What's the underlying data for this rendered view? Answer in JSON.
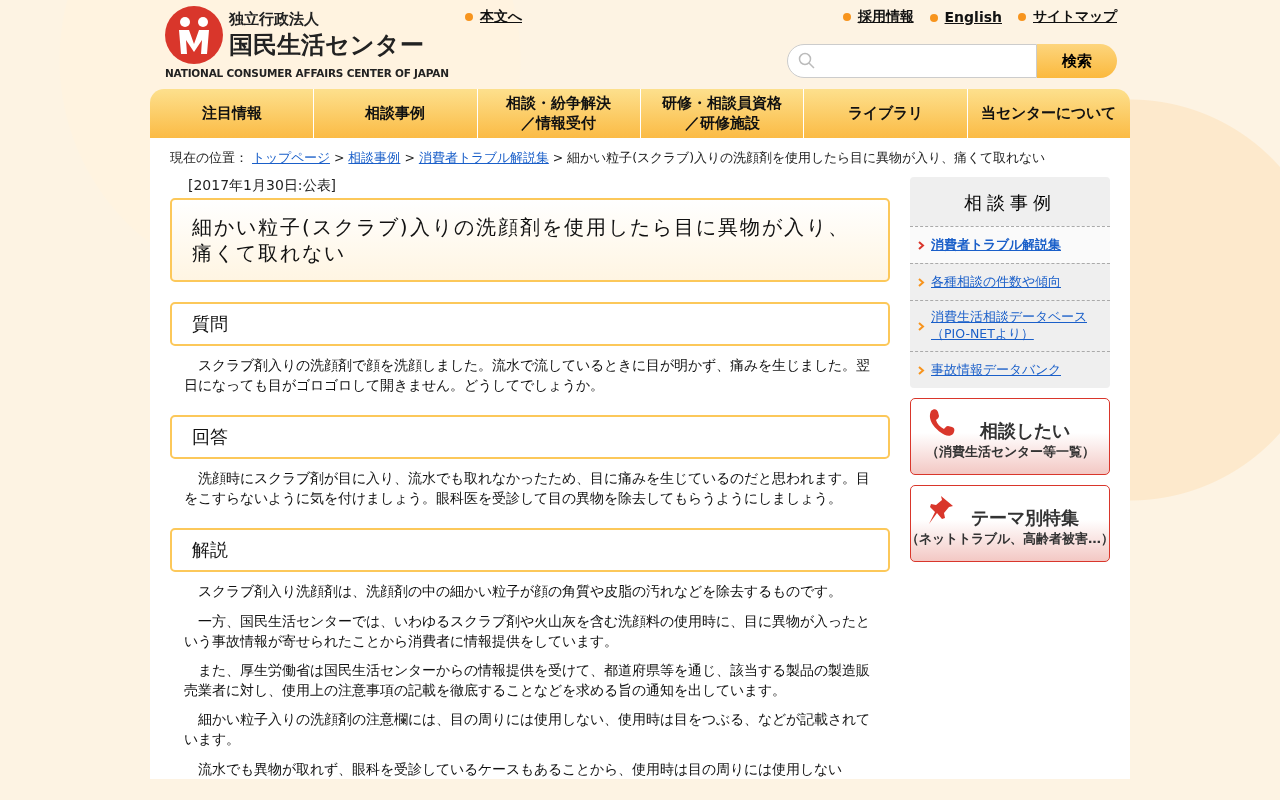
{
  "header": {
    "org_type": "独立行政法人",
    "org_name": "国民生活センター",
    "org_name_en": "NATIONAL CONSUMER AFFAIRS CENTER OF JAPAN",
    "skip_link": "本文へ",
    "links": [
      "採用情報",
      "English",
      "サイトマップ"
    ],
    "search": {
      "button": "検索"
    }
  },
  "nav": [
    {
      "lines": [
        "注目情報"
      ]
    },
    {
      "lines": [
        "相談事例"
      ]
    },
    {
      "lines": [
        "相談・紛争解決",
        "／情報受付"
      ]
    },
    {
      "lines": [
        "研修・相談員資格",
        "／研修施設"
      ]
    },
    {
      "lines": [
        "ライブラリ"
      ]
    },
    {
      "lines": [
        "当センターについて"
      ]
    }
  ],
  "breadcrumb": {
    "label": "現在の位置：",
    "separator": ">",
    "links": [
      "トップページ",
      "相談事例",
      "消費者トラブル解説集"
    ],
    "current": "細かい粒子(スクラブ)入りの洗顔剤を使用したら目に異物が入り、痛くて取れない"
  },
  "article": {
    "date": "[2017年1月30日:公表]",
    "title": "細かい粒子(スクラブ)入りの洗顔剤を使用したら目に異物が入り、痛くて取れない",
    "sections": [
      {
        "heading": "質問",
        "paragraphs": [
          "スクラブ剤入りの洗顔剤で顔を洗顔しました。流水で流しているときに目が明かず、痛みを生じました。翌日になっても目がゴロゴロして開きません。どうしてでしょうか。"
        ]
      },
      {
        "heading": "回答",
        "paragraphs": [
          "洗顔時にスクラブ剤が目に入り、流水でも取れなかったため、目に痛みを生じているのだと思われます。目をこすらないように気を付けましょう。眼科医を受診して目の異物を除去してもらうようにしましょう。"
        ]
      },
      {
        "heading": "解説",
        "paragraphs": [
          "スクラブ剤入り洗顔剤は、洗顔剤の中の細かい粒子が顔の角質や皮脂の汚れなどを除去するものです。",
          "一方、国民生活センターでは、いわゆるスクラブ剤や火山灰を含む洗顔料の使用時に、目に異物が入ったという事故情報が寄せられたことから消費者に情報提供をしています。",
          "また、厚生労働省は国民生活センターからの情報提供を受けて、都道府県等を通じ、該当する製品の製造販売業者に対し、使用上の注意事項の記載を徹底することなどを求める旨の通知を出しています。",
          "細かい粒子入りの洗顔剤の注意欄には、目の周りには使用しない、使用時は目をつぶる、などが記載されています。",
          "流水でも異物が取れず、眼科を受診しているケースもあることから、使用時は目の周りには使用しない"
        ]
      }
    ]
  },
  "sidebar": {
    "title": "相談事例",
    "items": [
      {
        "label": "消費者トラブル解説集",
        "selected": true
      },
      {
        "label": "各種相談の件数や傾向",
        "selected": false
      },
      {
        "label": "消費生活相談データベース（PIO-NETより）",
        "selected": false
      },
      {
        "label": "事故情報データバンク",
        "selected": false
      }
    ],
    "banners": [
      {
        "kind": "phone",
        "title": "相談したい",
        "subtitle": "（消費生活センター等一覧）"
      },
      {
        "kind": "pin",
        "title": "テーマ別特集",
        "subtitle": "（ネットトラブル、高齢者被害…）"
      }
    ]
  }
}
